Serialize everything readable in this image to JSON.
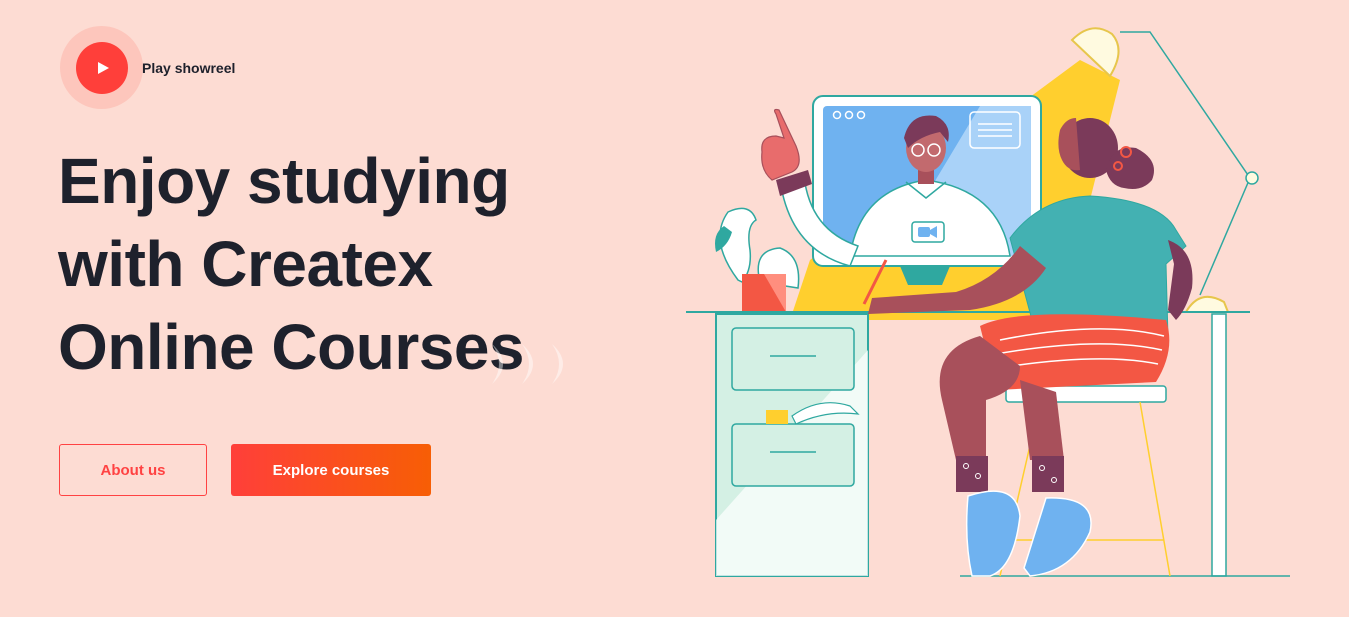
{
  "showreel": {
    "label": "Play showreel",
    "icon": "play-icon"
  },
  "headline": {
    "line1": "Enjoy studying",
    "line2": "with Createx",
    "line3": "Online Courses"
  },
  "buttons": {
    "about": "About us",
    "explore": "Explore courses"
  },
  "colors": {
    "background": "#fddcd3",
    "accent": "#ff3f3a",
    "accent_gradient_end": "#f75e05",
    "heading": "#1e212c"
  }
}
